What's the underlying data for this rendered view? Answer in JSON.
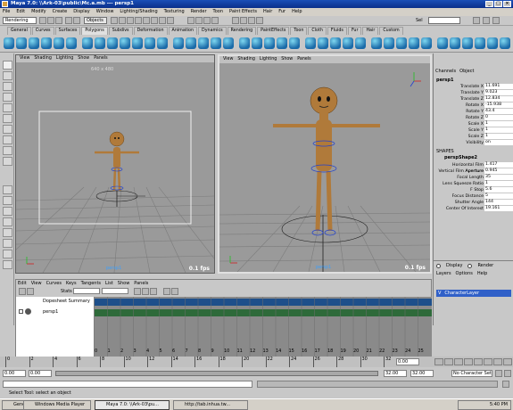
{
  "window": {
    "title": "Maya 7.0: \\\\Ark-03\\public\\Mc.a.mb  ---  persp1",
    "controls": [
      "_",
      "□",
      "×"
    ]
  },
  "menubar": [
    "File",
    "Edit",
    "Modify",
    "Create",
    "Display",
    "Window",
    "Lighting/Shading",
    "Texturing",
    "Render",
    "Toon",
    "Paint Effects",
    "Hair",
    "Fur",
    "Help"
  ],
  "statusline": {
    "menu_set": "Rendering",
    "selection_mode": "Objects",
    "sel_label": "Sel",
    "search": ""
  },
  "shelf_tabs": [
    "General",
    "Curves",
    "Surfaces",
    "Polygons",
    "Subdivs",
    "Deformation",
    "Animation",
    "Dynamics",
    "Rendering",
    "PaintEffects",
    "Toon",
    "Cloth",
    "Fluids",
    "Fur",
    "Hair",
    "Custom"
  ],
  "active_shelf_tab": "Polygons",
  "viewport_menu": [
    "View",
    "Shading",
    "Lighting",
    "Show",
    "Panels"
  ],
  "viewport_left": {
    "resolution": "640 x 480",
    "camera": "persp1",
    "fps": "0.1 fps"
  },
  "viewport_right": {
    "camera": "persp1",
    "fps": "0.1 fps"
  },
  "channel_box": {
    "menu": [
      "Channels",
      "Object"
    ],
    "object": "persp1",
    "attrs": [
      {
        "label": "Translate X",
        "value": "11.691"
      },
      {
        "label": "Translate Y",
        "value": "9.023"
      },
      {
        "label": "Translate Z",
        "value": "12.834"
      },
      {
        "label": "Rotate X",
        "value": "-15.938"
      },
      {
        "label": "Rotate Y",
        "value": "43.4"
      },
      {
        "label": "Rotate Z",
        "value": "0"
      },
      {
        "label": "Scale X",
        "value": "1"
      },
      {
        "label": "Scale Y",
        "value": "1"
      },
      {
        "label": "Scale Z",
        "value": "1"
      },
      {
        "label": "Visibility",
        "value": "on"
      }
    ],
    "shapes_header": "SHAPES",
    "shape_name": "perspShape2",
    "shape_attrs": [
      {
        "label": "Horizontal Film Aperture",
        "value": "1.417"
      },
      {
        "label": "Vertical Film Aperture",
        "value": "0.945"
      },
      {
        "label": "Focal Length",
        "value": "35"
      },
      {
        "label": "Lens Squeeze Ratio",
        "value": "1"
      },
      {
        "label": "F Stop",
        "value": "5.6"
      },
      {
        "label": "Focus Distance",
        "value": "5"
      },
      {
        "label": "Shutter Angle",
        "value": "144"
      },
      {
        "label": "Center Of Interest",
        "value": "19.161"
      }
    ]
  },
  "layer_editor": {
    "modes": [
      "Display",
      "Render"
    ],
    "menu": [
      "Layers",
      "Options",
      "Help"
    ],
    "layers": [
      {
        "v": "V",
        "name": "CharacterLayer"
      }
    ]
  },
  "dopesheet": {
    "menu": [
      "Edit",
      "View",
      "Curves",
      "Keys",
      "Tangents",
      "List",
      "Show",
      "Panels"
    ],
    "stats_label": "Stats",
    "outline": [
      "Dopesheet Summary",
      "persp1"
    ],
    "frame_numbers": [
      "0",
      "1",
      "2",
      "3",
      "4",
      "5",
      "6",
      "7",
      "8",
      "9",
      "10",
      "11",
      "12",
      "13",
      "14",
      "15",
      "16",
      "17",
      "18",
      "19",
      "20",
      "21",
      "22",
      "23",
      "24",
      "25"
    ]
  },
  "timeslider": {
    "ticks": [
      "0",
      "2",
      "4",
      "6",
      "8",
      "10",
      "12",
      "14",
      "16",
      "18",
      "20",
      "22",
      "24",
      "26",
      "28",
      "30",
      "32"
    ],
    "current": "0.00"
  },
  "range": {
    "start": "0.00",
    "start2": "0.00",
    "end": "32.00",
    "end2": "32.00",
    "char_set": "No Character Set"
  },
  "helpline": "Select Tool: select an object",
  "taskbar": {
    "items": [
      "General",
      "Windows Media Player",
      "Maya 7.0: \\\\Ark-03\\pu...",
      "http://tab.inhua.tw..."
    ],
    "time": "5:40 PM"
  }
}
